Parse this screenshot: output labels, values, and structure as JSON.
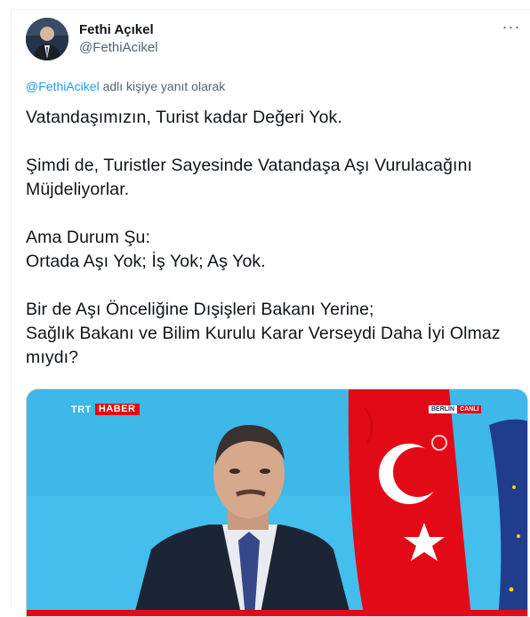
{
  "author": {
    "name": "Fethi Açıkel",
    "handle": "@FethiAcikel"
  },
  "menu": {
    "more_label": "···"
  },
  "reply_context": {
    "mention": "@FethiAcikel",
    "text": " adlı kişiye yanıt olarak"
  },
  "tweet": {
    "paragraphs": [
      "Vatandaşımızın, Turist kadar Değeri Yok.",
      "Şimdi de, Turistler Sayesinde Vatandaşa Aşı Vurulacağını Müjdeliyorlar.",
      "Ama Durum Şu:\nOrtada Aşı Yok; İş Yok; Aş Yok.",
      "Bir de Aşı Önceliğine Dışişleri Bakanı Yerine;\nSağlık Bakanı ve Bilim Kurulu Karar Verseydi Daha İyi Olmaz mıydı?"
    ]
  },
  "media": {
    "channel_logo": {
      "part1": "TRT",
      "part2": "HABER"
    },
    "live_badge": {
      "city": "BERLİN",
      "status": "CANLI"
    },
    "colors": {
      "background": "#3db8e8",
      "flag_red": "#e30a17",
      "eu_blue": "#1f3d8c"
    }
  }
}
